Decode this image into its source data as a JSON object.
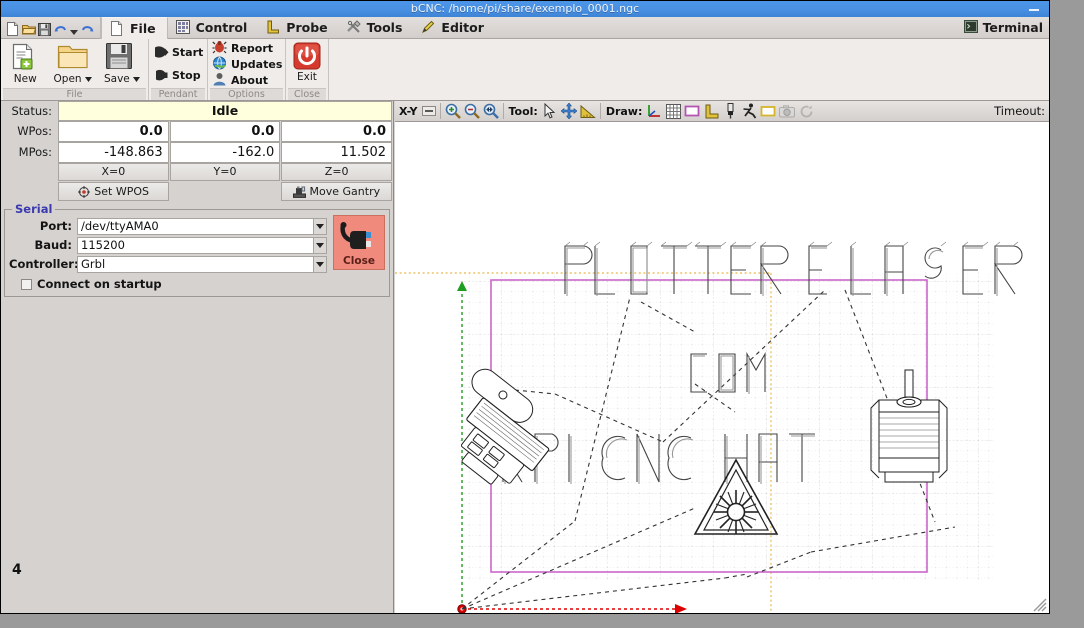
{
  "window": {
    "title": "bCNC: /home/pi/share/exemplo_0001.ngc",
    "minimize_label": "—"
  },
  "menu": {
    "quick_access": [
      {
        "name": "new-file-icon",
        "label": "New file"
      },
      {
        "name": "open-folder-icon",
        "label": "Open"
      },
      {
        "name": "save-icon",
        "label": "Save"
      },
      {
        "name": "undo-icon",
        "label": "Undo"
      },
      {
        "name": "undo-dropdown-icon",
        "label": "Undo history"
      },
      {
        "name": "redo-icon",
        "label": "Redo"
      }
    ],
    "tabs": [
      {
        "label": "File",
        "icon": "page-icon",
        "active": true
      },
      {
        "label": "Control",
        "icon": "control-grid-icon",
        "active": false
      },
      {
        "label": "Probe",
        "icon": "probe-corner-icon",
        "active": false
      },
      {
        "label": "Tools",
        "icon": "tools-wrench-icon",
        "active": false
      },
      {
        "label": "Editor",
        "icon": "editor-pencil-icon",
        "active": false
      }
    ],
    "terminal": {
      "label": "Terminal",
      "icon": "terminal-icon"
    }
  },
  "ribbon": {
    "groups": [
      {
        "label": "File",
        "buttons": [
          {
            "label": "New",
            "icon": "new-document-icon"
          },
          {
            "label": "Open",
            "icon": "open-folder-icon",
            "dropdown": true
          },
          {
            "label": "Save",
            "icon": "floppy-save-icon",
            "dropdown": true
          }
        ]
      },
      {
        "label": "Pendant",
        "buttons": [
          {
            "label": "Start",
            "icon": "start-play-icon"
          },
          {
            "label": "Stop",
            "icon": "stop-icon"
          }
        ]
      },
      {
        "label": "Options",
        "buttons": [
          {
            "label": "Report",
            "icon": "report-bug-icon"
          },
          {
            "label": "Updates",
            "icon": "updates-globe-icon"
          },
          {
            "label": "About",
            "icon": "about-person-icon"
          }
        ]
      },
      {
        "label": "Close",
        "buttons": [
          {
            "label": "Exit",
            "icon": "power-exit-icon"
          }
        ]
      }
    ]
  },
  "state": {
    "status_label": "Status:",
    "status_value": "Idle",
    "wpos_label": "WPos:",
    "wpos": [
      "0.0",
      "0.0",
      "0.0"
    ],
    "mpos_label": "MPos:",
    "mpos": [
      "-148.863",
      "-162.0",
      "11.502"
    ],
    "zero_buttons": [
      "X=0",
      "Y=0",
      "Z=0"
    ],
    "set_wpos_label": "Set WPOS",
    "set_wpos_icon": "crosshair-icon",
    "move_gantry_label": "Move Gantry",
    "move_gantry_icon": "gantry-icon"
  },
  "serial": {
    "legend": "Serial",
    "fields": [
      {
        "label": "Port:",
        "value": "/dev/ttyAMA0"
      },
      {
        "label": "Baud:",
        "value": "115200"
      },
      {
        "label": "Controller:",
        "value": "Grbl"
      }
    ],
    "connect_on_startup": {
      "label": "Connect on startup",
      "checked": false
    },
    "close_button": {
      "label": "Close",
      "icon": "plug-disconnect-icon"
    }
  },
  "left_panel": {
    "page_number": "4"
  },
  "canvas_toolbar": {
    "view_label": "X-Y",
    "view_dropdown_icon": "view-dropdown-icon",
    "zoom_buttons": [
      {
        "name": "zoom-in-icon",
        "label": "Zoom In"
      },
      {
        "name": "zoom-out-icon",
        "label": "Zoom Out"
      },
      {
        "name": "zoom-fit-icon",
        "label": "Zoom Fit"
      }
    ],
    "tool_label": "Tool:",
    "tool_buttons": [
      {
        "name": "select-arrow-icon",
        "label": "Select"
      },
      {
        "name": "pan-move-icon",
        "label": "Pan"
      },
      {
        "name": "ruler-icon",
        "label": "Ruler"
      }
    ],
    "draw_label": "Draw:",
    "draw_buttons": [
      {
        "name": "axes-icon",
        "label": "Axes"
      },
      {
        "name": "grid-icon",
        "label": "Grid"
      },
      {
        "name": "margin-rect-icon",
        "label": "Margin"
      },
      {
        "name": "workarea-icon",
        "label": "Work area"
      },
      {
        "name": "probe-pin-icon",
        "label": "Probe"
      },
      {
        "name": "rapid-move-icon",
        "label": "Rapid moves"
      },
      {
        "name": "bounds-rect-icon",
        "label": "Bounds"
      },
      {
        "name": "camera-icon",
        "label": "Camera"
      },
      {
        "name": "refresh-icon",
        "label": "Refresh"
      }
    ],
    "timeout_label": "Timeout:"
  },
  "canvas": {
    "toolpath_texts": [
      "PLOTTER E LASER",
      "COM",
      "RPI CNC HAT"
    ],
    "origin_marker": "origin-point",
    "x_axis_color": "#dd0000",
    "y_axis_color": "#00a000",
    "margin_color": "#cc66cc",
    "work_area_color": "#e8b84b"
  }
}
